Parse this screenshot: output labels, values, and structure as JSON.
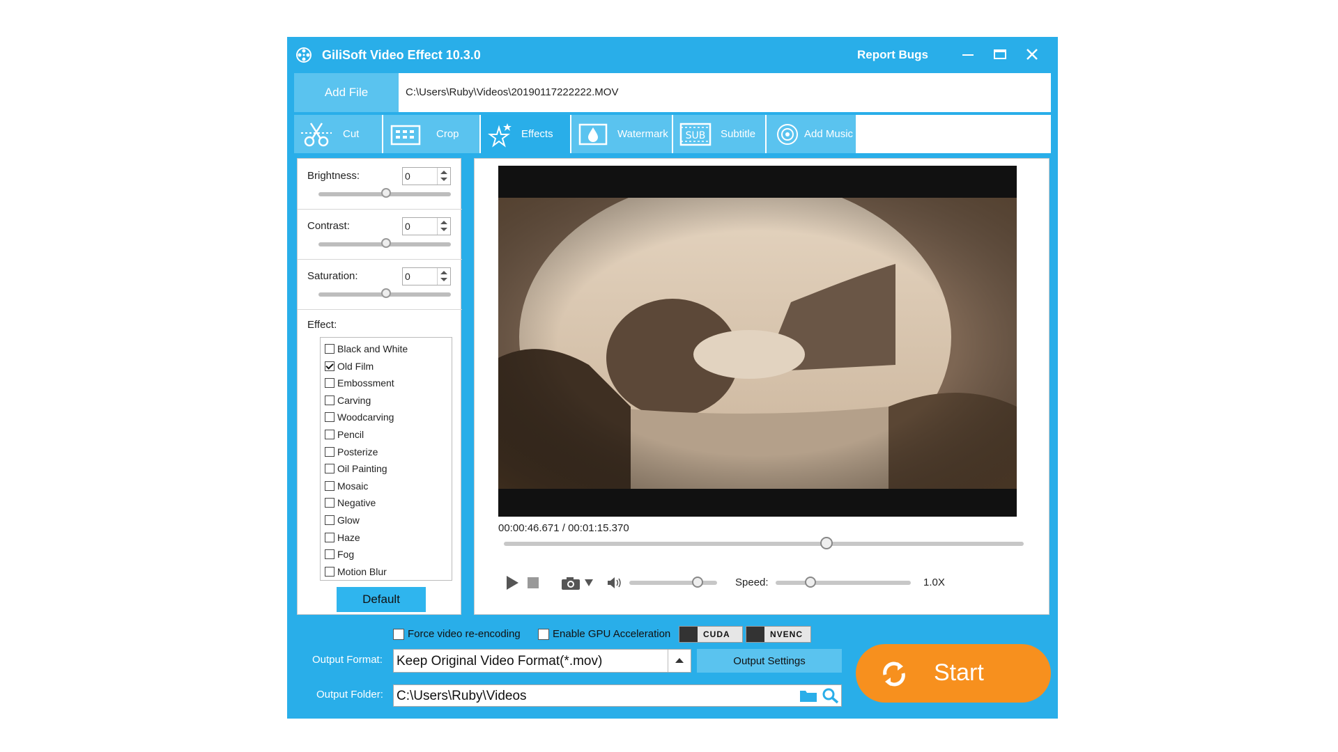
{
  "window": {
    "title": "GiliSoft Video Effect 10.3.0",
    "report_bugs": "Report Bugs"
  },
  "file": {
    "add_file": "Add File",
    "path": "C:\\Users\\Ruby\\Videos\\20190117222222.MOV"
  },
  "tabs": [
    {
      "label": "Cut",
      "icon": "scissors-icon"
    },
    {
      "label": "Crop",
      "icon": "crop-icon"
    },
    {
      "label": "Effects",
      "icon": "effects-stars-icon"
    },
    {
      "label": "Watermark",
      "icon": "watermark-drop-icon"
    },
    {
      "label": "Subtitle",
      "icon": "subtitle-icon"
    },
    {
      "label": "Add Music",
      "icon": "music-target-icon"
    }
  ],
  "adjust": {
    "brightness": {
      "label": "Brightness:",
      "value": "0"
    },
    "contrast": {
      "label": "Contrast:",
      "value": "0"
    },
    "saturation": {
      "label": "Saturation:",
      "value": "0"
    }
  },
  "effects": {
    "title": "Effect:",
    "items": [
      {
        "label": "Black and White",
        "checked": false
      },
      {
        "label": "Old Film",
        "checked": true
      },
      {
        "label": "Embossment",
        "checked": false
      },
      {
        "label": "Carving",
        "checked": false
      },
      {
        "label": "Woodcarving",
        "checked": false
      },
      {
        "label": "Pencil",
        "checked": false
      },
      {
        "label": "Posterize",
        "checked": false
      },
      {
        "label": "Oil Painting",
        "checked": false
      },
      {
        "label": "Mosaic",
        "checked": false
      },
      {
        "label": "Negative",
        "checked": false
      },
      {
        "label": "Glow",
        "checked": false
      },
      {
        "label": "Haze",
        "checked": false
      },
      {
        "label": "Fog",
        "checked": false
      },
      {
        "label": "Motion Blur",
        "checked": false
      }
    ],
    "default_button": "Default"
  },
  "player": {
    "timecode": "00:00:46.671 / 00:01:15.370",
    "speed_label": "Speed:",
    "speed_value": "1.0X"
  },
  "options": {
    "force_reencode": "Force video re-encoding",
    "gpu_accel": "Enable GPU Acceleration",
    "cuda": "CUDA",
    "nvenc": "NVENC"
  },
  "output": {
    "format_label": "Output Format:",
    "format_value": "Keep Original Video Format(*.mov)",
    "settings_button": "Output Settings",
    "folder_label": "Output Folder:",
    "folder_value": "C:\\Users\\Ruby\\Videos"
  },
  "start": {
    "label": "Start"
  },
  "colors": {
    "accent": "#29aee9",
    "tab_light": "#5ac3ef",
    "start": "#f7901e",
    "sepia": "#a08566"
  }
}
